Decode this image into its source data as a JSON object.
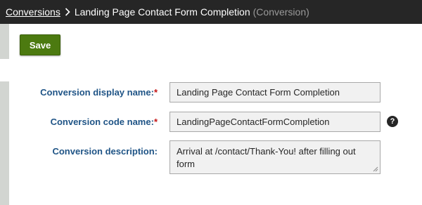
{
  "breadcrumb": {
    "parent_label": "Conversions",
    "current_label": "Landing Page Contact Form Completion",
    "current_suffix": "(Conversion)"
  },
  "toolbar": {
    "save_label": "Save"
  },
  "form": {
    "display_name": {
      "label": "Conversion display name:",
      "required_mark": "*",
      "value": "Landing Page Contact Form Completion"
    },
    "code_name": {
      "label": "Conversion code name:",
      "required_mark": "*",
      "value": "LandingPageContactFormCompletion",
      "help_icon": "?"
    },
    "description": {
      "label": "Conversion description:",
      "value": "Arrival at /contact/Thank-You! after filling out form"
    }
  },
  "colors": {
    "topbar_bg": "#262626",
    "save_button_bg": "#4c7a10",
    "label_color": "#1f5486",
    "required_color": "#c31414"
  }
}
